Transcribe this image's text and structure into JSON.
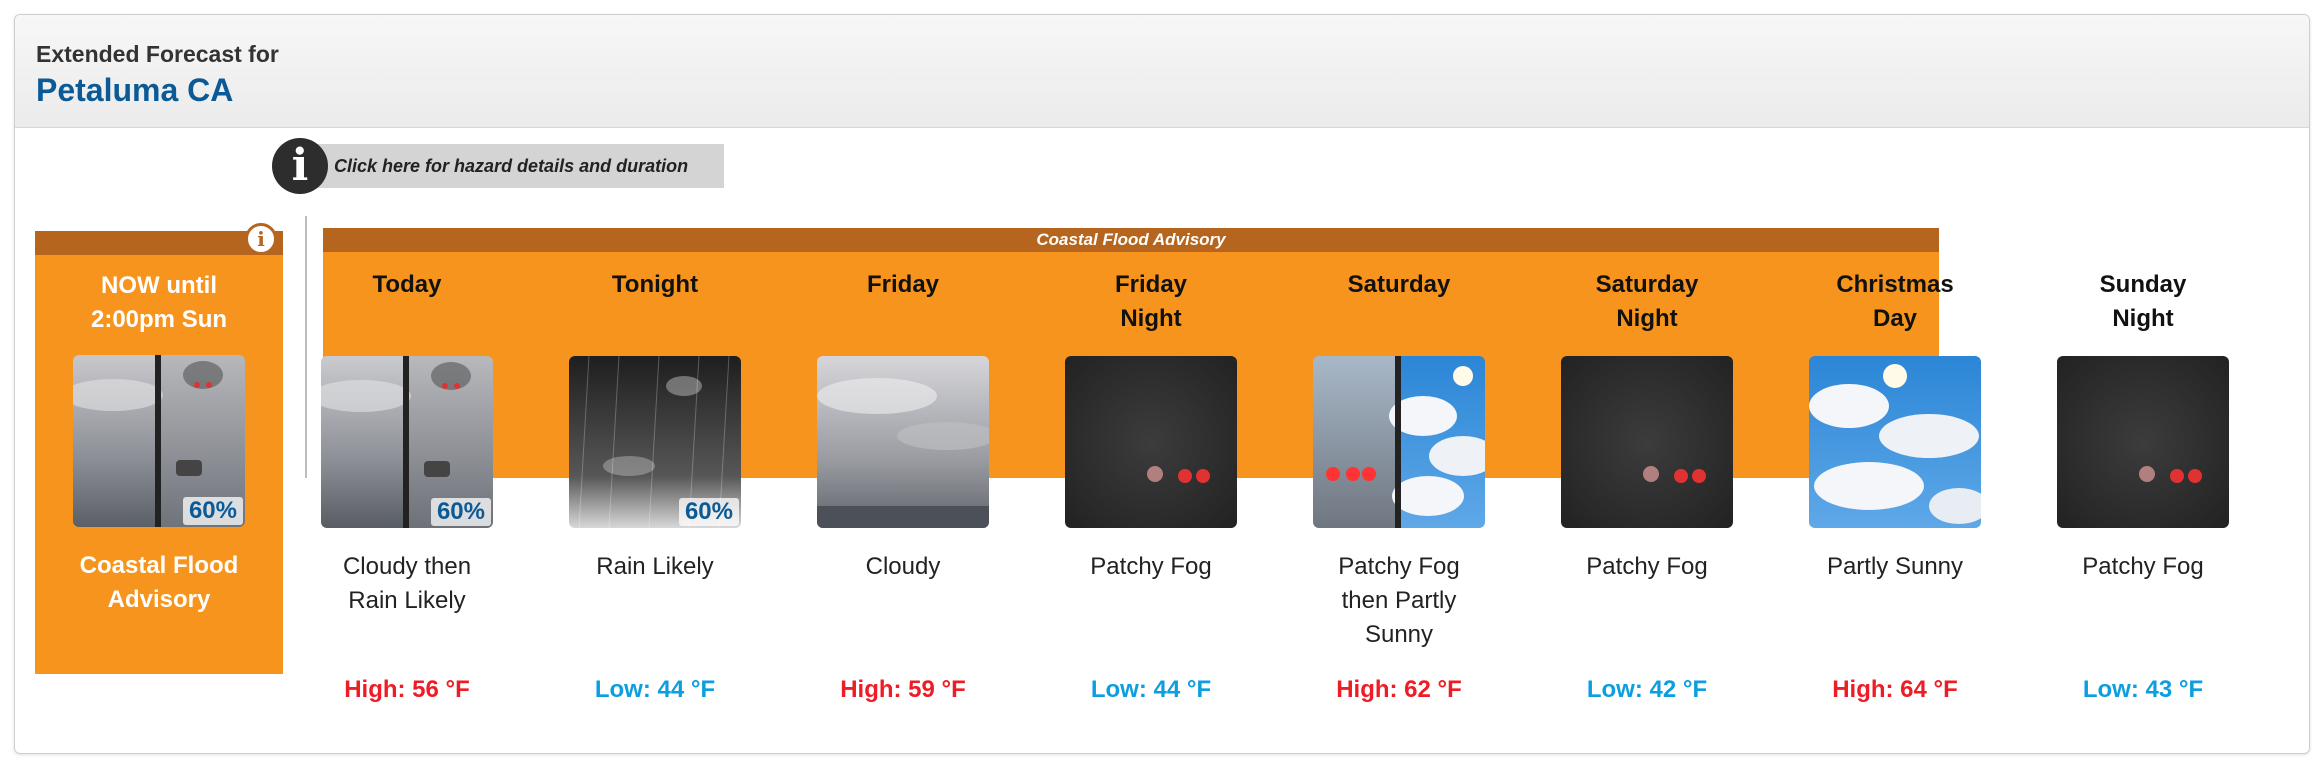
{
  "header": {
    "label": "Extended Forecast for",
    "location": "Petaluma CA"
  },
  "hazard": {
    "link_text": "Click here for hazard details and duration",
    "advisory_label": "Coastal Flood Advisory"
  },
  "now": {
    "line1": "NOW until",
    "line2": "2:00pm Sun",
    "pop": "60%",
    "condition_line1": "Coastal Flood",
    "condition_line2": "Advisory"
  },
  "periods": [
    {
      "name_line1": "Today",
      "name_line2": "",
      "cond_line1": "Cloudy then",
      "cond_line2": "Rain Likely",
      "cond_line3": "",
      "pop": "60%",
      "temp": "High: 56 °F",
      "temp_type": "high",
      "icon": "cloudy-rain-split-icon"
    },
    {
      "name_line1": "Tonight",
      "name_line2": "",
      "cond_line1": "Rain Likely",
      "cond_line2": "",
      "cond_line3": "",
      "pop": "60%",
      "temp": "Low: 44 °F",
      "temp_type": "low",
      "icon": "rain-night-icon"
    },
    {
      "name_line1": "Friday",
      "name_line2": "",
      "cond_line1": "Cloudy",
      "cond_line2": "",
      "cond_line3": "",
      "pop": "",
      "temp": "High: 59 °F",
      "temp_type": "high",
      "icon": "cloudy-icon"
    },
    {
      "name_line1": "Friday",
      "name_line2": "Night",
      "cond_line1": "Patchy Fog",
      "cond_line2": "",
      "cond_line3": "",
      "pop": "",
      "temp": "Low: 44 °F",
      "temp_type": "low",
      "icon": "fog-night-icon"
    },
    {
      "name_line1": "Saturday",
      "name_line2": "",
      "cond_line1": "Patchy Fog",
      "cond_line2": "then Partly",
      "cond_line3": "Sunny",
      "pop": "",
      "temp": "High: 62 °F",
      "temp_type": "high",
      "icon": "fog-partly-sunny-split-icon"
    },
    {
      "name_line1": "Saturday",
      "name_line2": "Night",
      "cond_line1": "Patchy Fog",
      "cond_line2": "",
      "cond_line3": "",
      "pop": "",
      "temp": "Low: 42 °F",
      "temp_type": "low",
      "icon": "fog-night-icon"
    },
    {
      "name_line1": "Christmas",
      "name_line2": "Day",
      "cond_line1": "Partly Sunny",
      "cond_line2": "",
      "cond_line3": "",
      "pop": "",
      "temp": "High: 64 °F",
      "temp_type": "high",
      "icon": "partly-sunny-icon"
    },
    {
      "name_line1": "Sunday",
      "name_line2": "Night",
      "cond_line1": "Patchy Fog",
      "cond_line2": "",
      "cond_line3": "",
      "pop": "",
      "temp": "Low: 43 °F",
      "temp_type": "low",
      "icon": "fog-night-icon"
    }
  ],
  "colors": {
    "advisory": "#f7941d",
    "advisory_strip": "#b5651d",
    "high": "#ee1c25",
    "low": "#0c9ede",
    "title": "#0b5a96"
  }
}
